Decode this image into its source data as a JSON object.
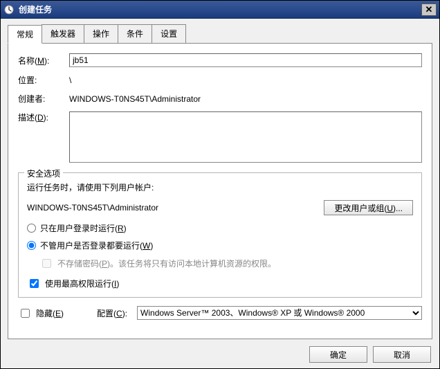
{
  "titlebar": {
    "title": "创建任务",
    "close_glyph": "✕"
  },
  "tabs": {
    "general": "常规",
    "triggers": "触发器",
    "actions": "操作",
    "conditions": "条件",
    "settings": "设置"
  },
  "general": {
    "name_label": "名称(M):",
    "name_value": "jb51",
    "location_label": "位置:",
    "location_value": "\\",
    "creator_label": "创建者:",
    "creator_value": "WINDOWS-T0NS45T\\Administrator",
    "description_label": "描述(D):",
    "description_value": ""
  },
  "security": {
    "legend": "安全选项",
    "run_as_label": "运行任务时，请使用下列用户帐户:",
    "account": "WINDOWS-T0NS45T\\Administrator",
    "change_user_btn": "更改用户或组(U)...",
    "radio_logged_on": "只在用户登录时运行(R)",
    "radio_any_login": "不管用户是否登录都要运行(W)",
    "nostore_pwd": "不存储密码(P)。该任务将只有访问本地计算机资源的权限。",
    "highest_priv": "使用最高权限运行(I)",
    "radio_selected": "any",
    "highest_priv_checked": true,
    "nostore_pwd_checked": false
  },
  "bottom": {
    "hidden_label": "隐藏(E)",
    "hidden_checked": false,
    "config_label": "配置(C):",
    "config_value": "Windows Server™ 2003、Windows® XP 或 Windows® 2000"
  },
  "dialog": {
    "ok": "确定",
    "cancel": "取消"
  }
}
